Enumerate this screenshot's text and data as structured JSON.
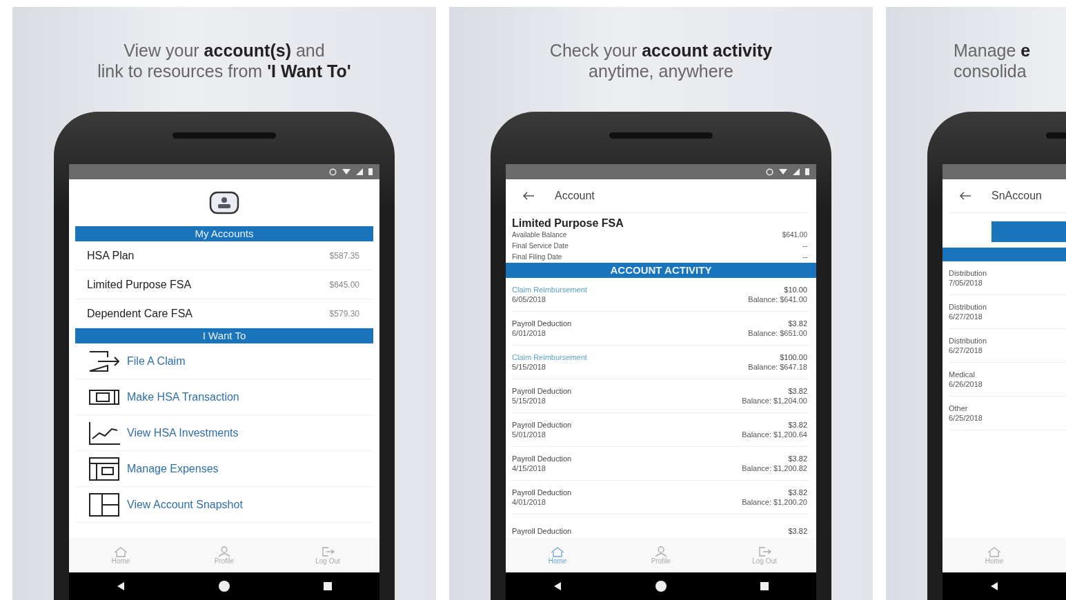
{
  "panels": [
    {
      "kind": "menu",
      "caption": [
        "View your **account(s)** and",
        "link to resources from **'I Want To'**"
      ],
      "accounts_header": "My Accounts",
      "accounts": [
        {
          "name": "HSA Plan",
          "amount": "$587.35"
        },
        {
          "name": "Limited Purpose FSA",
          "amount": "$645.00"
        },
        {
          "name": "Dependent Care FSA",
          "amount": "$579.30"
        }
      ],
      "actions_header": "I Want To",
      "actions": [
        "File A Claim",
        "Make HSA Transaction",
        "View HSA Investments",
        "Manage Expenses",
        "View Account Snapshot"
      ],
      "nav": [
        {
          "label": "Home",
          "selected": false
        },
        {
          "label": "Profile",
          "selected": false
        },
        {
          "label": "Log Out",
          "selected": false
        }
      ]
    },
    {
      "kind": "activity",
      "caption": [
        "Check your **account activity**",
        "anytime, anywhere"
      ],
      "title": "Account",
      "account": "Limited Purpose FSA",
      "details": [
        {
          "label": "Available Balance",
          "value": "$641.00"
        },
        {
          "label": "Final Service Date",
          "value": "--"
        },
        {
          "label": "Final Filing Date",
          "value": "--"
        }
      ],
      "section": "ACCOUNT ACTIVITY",
      "transactions": [
        {
          "kind": "claim",
          "name": "Claim Reimbursement",
          "date": "6/05/2018",
          "amount": "$10.00",
          "balance": "Balance: $641.00"
        },
        {
          "kind": "payroll",
          "name": "Payroll Deduction",
          "date": "6/01/2018",
          "amount": "$3.82",
          "balance": "Balance: $651.00"
        },
        {
          "kind": "claim",
          "name": "Claim Reimbursement",
          "date": "5/15/2018",
          "amount": "$100.00",
          "balance": "Balance: $647.18"
        },
        {
          "kind": "payroll",
          "name": "Payroll Deduction",
          "date": "5/15/2018",
          "amount": "$3.82",
          "balance": "Balance: $1,204.00"
        },
        {
          "kind": "payroll",
          "name": "Payroll Deduction",
          "date": "5/01/2018",
          "amount": "$3.82",
          "balance": "Balance: $1,200.64"
        },
        {
          "kind": "payroll",
          "name": "Payroll Deduction",
          "date": "4/15/2018",
          "amount": "$3.82",
          "balance": "Balance: $1,200.82"
        },
        {
          "kind": "payroll",
          "name": "Payroll Deduction",
          "date": "4/01/2018",
          "amount": "$3.82",
          "balance": "Balance: $1,200.20"
        },
        {
          "kind": "payroll",
          "name": "Payroll Deduction",
          "amount": "$3.82"
        }
      ],
      "nav": [
        {
          "label": "Home",
          "selected": true
        },
        {
          "label": "Profile",
          "selected": false
        },
        {
          "label": "Log Out",
          "selected": false
        }
      ]
    },
    {
      "kind": "list",
      "caption": [
        "Manage **e**",
        "consolida"
      ],
      "title": "SnAccoun",
      "entries": [
        {
          "name": "Distribution",
          "date": "7/05/2018"
        },
        {
          "name": "Distribution",
          "date": "6/27/2018"
        },
        {
          "name": "Distribution",
          "date": "6/27/2018"
        },
        {
          "name": "Medical",
          "date": "6/26/2018"
        },
        {
          "name": "Other",
          "date": "6/25/2018"
        }
      ],
      "nav": [
        {
          "label": "Home",
          "selected": false
        }
      ]
    }
  ]
}
